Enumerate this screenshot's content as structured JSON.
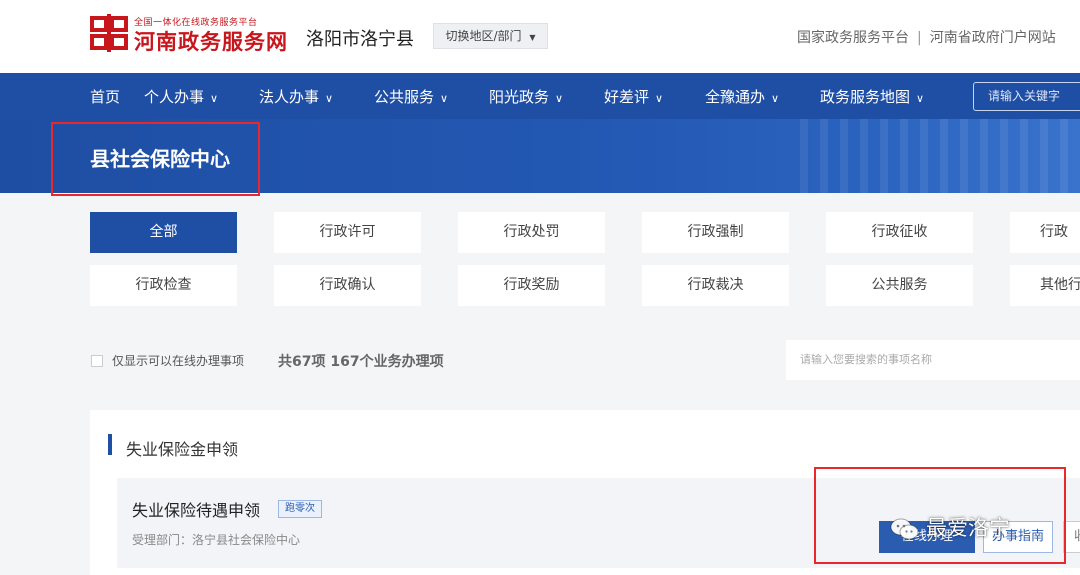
{
  "header": {
    "logo_small": "全国一体化在线政务服务平台",
    "logo_big": "河南政务服务网",
    "region": "洛阳市洛宁县",
    "switch_label": "切换地区/部门",
    "top_links": [
      "国家政务服务平台",
      "河南省政府门户网站"
    ],
    "brand_color": "#c8161d"
  },
  "nav": {
    "items": [
      {
        "label": "首页",
        "dropdown": false
      },
      {
        "label": "个人办事",
        "dropdown": true
      },
      {
        "label": "法人办事",
        "dropdown": true
      },
      {
        "label": "公共服务",
        "dropdown": true
      },
      {
        "label": "阳光政务",
        "dropdown": true
      },
      {
        "label": "好差评",
        "dropdown": true
      },
      {
        "label": "全豫通办",
        "dropdown": true
      },
      {
        "label": "政务服务地图",
        "dropdown": true
      }
    ],
    "search_placeholder": "请输入关键字",
    "bg_color": "#1f4fa5"
  },
  "banner": {
    "title": "县社会保险中心"
  },
  "categories": {
    "row1": [
      "全部",
      "行政许可",
      "行政处罚",
      "行政强制",
      "行政征收",
      "行政"
    ],
    "row2": [
      "行政检查",
      "行政确认",
      "行政奖励",
      "行政裁决",
      "公共服务",
      "其他行"
    ],
    "active": "全部"
  },
  "filter": {
    "only_online_label": "仅显示可以在线办理事项",
    "only_online_checked": false,
    "total_text": "共67项 167个业务办理项",
    "search_placeholder": "请输入您要搜索的事项名称"
  },
  "results": {
    "section_title": "失业保险金申领",
    "item": {
      "title": "失业保险待遇申领",
      "tag": "跑零次",
      "dept": "受理部门：洛宁县社会保险中心",
      "btn_online": "在线办理",
      "btn_guide": "办事指南",
      "btn_more": "收"
    }
  },
  "watermark": {
    "text": "最爱洛宁",
    "icon": "wechat-icon"
  }
}
